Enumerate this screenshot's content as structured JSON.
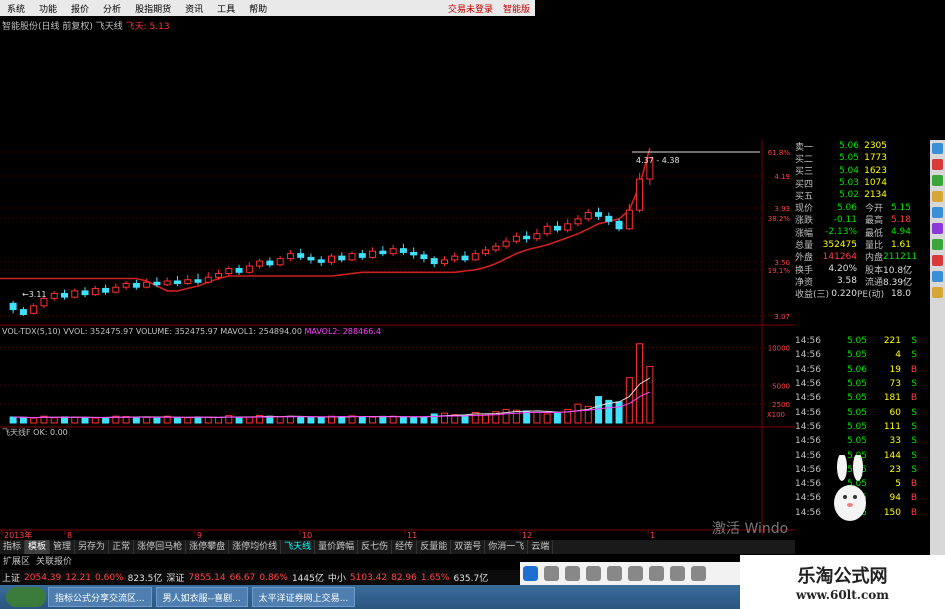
{
  "menu": [
    "系统",
    "功能",
    "报价",
    "分析",
    "股指期货",
    "资讯",
    "工具",
    "帮助"
  ],
  "menu_right": [
    "交易未登录",
    "智能版"
  ],
  "title": {
    "stock": "智能股份(日线 前复权)",
    "indicator": "飞天线",
    "value": "飞天: 5.13"
  },
  "price_axis": [
    "61.8%",
    "4.19",
    "3.93",
    "38.2%",
    "3.50",
    "19.1%",
    "3.07"
  ],
  "price_annot": {
    "range": "4.37 - 4.38",
    "low": "3.11"
  },
  "vol_header": {
    "name": "VOL-TDX(5,10)",
    "vvol": "VVOL: 352475.97",
    "volume": "VOLUME: 352475.97",
    "mavol1": "MAVOL1: 254894.00",
    "mavol2": "MAVOL2: 288466.4"
  },
  "vol_axis": [
    "10000",
    "5000",
    "2500",
    "X100"
  ],
  "ind_header": {
    "name": "飞天线F",
    "ok": "OK: 0.00"
  },
  "date_axis": [
    "2013年",
    "8",
    "9",
    "10",
    "11",
    "12",
    "1"
  ],
  "quote": {
    "asks": [
      {
        "label": "卖一",
        "price": "5.06",
        "vol": "2305"
      },
      {
        "label": "买二",
        "price": "5.05",
        "vol": "1773"
      },
      {
        "label": "买三",
        "price": "5.04",
        "vol": "1623"
      },
      {
        "label": "买四",
        "price": "5.03",
        "vol": "1074"
      },
      {
        "label": "买五",
        "price": "5.02",
        "vol": "2134"
      }
    ],
    "stats": [
      {
        "a": "现价",
        "b": "5.06",
        "bc": "green",
        "c": "今开",
        "d": "5.15",
        "dc": "green"
      },
      {
        "a": "涨跌",
        "b": "-0.11",
        "bc": "green",
        "c": "最高",
        "d": "5.18",
        "dc": "red"
      },
      {
        "a": "涨幅",
        "b": "-2.13%",
        "bc": "green",
        "c": "最低",
        "d": "4.94",
        "dc": "green"
      },
      {
        "a": "总量",
        "b": "352475",
        "bc": "yel",
        "c": "量比",
        "d": "1.61",
        "dc": "yel"
      },
      {
        "a": "外盘",
        "b": "141264",
        "bc": "red",
        "c": "内盘",
        "d": "211211",
        "dc": "green"
      },
      {
        "a": "换手",
        "b": "4.20%",
        "bc": "wht",
        "c": "股本",
        "d": "10.8亿",
        "dc": "wht"
      },
      {
        "a": "净资",
        "b": "3.58",
        "bc": "wht",
        "c": "流通",
        "d": "8.39亿",
        "dc": "wht"
      },
      {
        "a": "收益(三)",
        "b": "0.220",
        "bc": "wht",
        "c": "PE(动)",
        "d": "18.0",
        "dc": "wht"
      }
    ]
  },
  "ticks": [
    {
      "t": "14:56",
      "p": "5.05",
      "v": "221",
      "s": "S"
    },
    {
      "t": "14:56",
      "p": "5.05",
      "v": "4",
      "s": "S"
    },
    {
      "t": "14:56",
      "p": "5.06",
      "v": "19",
      "s": "B"
    },
    {
      "t": "14:56",
      "p": "5.05",
      "v": "73",
      "s": "S"
    },
    {
      "t": "14:56",
      "p": "5.05",
      "v": "181",
      "s": "B"
    },
    {
      "t": "14:56",
      "p": "5.05",
      "v": "60",
      "s": "S"
    },
    {
      "t": "14:56",
      "p": "5.05",
      "v": "111",
      "s": "S"
    },
    {
      "t": "14:56",
      "p": "5.05",
      "v": "33",
      "s": "S"
    },
    {
      "t": "14:56",
      "p": "5.05",
      "v": "144",
      "s": "S"
    },
    {
      "t": "14:56",
      "p": "5.05",
      "v": "23",
      "s": "S"
    },
    {
      "t": "14:56",
      "p": "5.05",
      "v": "5",
      "s": "B"
    },
    {
      "t": "14:56",
      "p": "5.05",
      "v": "94",
      "s": "B"
    },
    {
      "t": "14:56",
      "p": "5.05",
      "v": "150",
      "s": "B"
    }
  ],
  "tabs": [
    "指标",
    "模板",
    "管理",
    "另存为",
    "正常",
    "涨停回马枪",
    "涨停攀盘",
    "涨停均价线",
    "飞天线",
    "量价跨幅",
    "反七伤",
    "经传",
    "反量能",
    "双谐号",
    "你消一飞",
    "云端"
  ],
  "tab_active": 8,
  "subtabs": [
    "扩展区",
    "关联报价"
  ],
  "status": [
    {
      "t": "上证",
      "c": "wht"
    },
    {
      "t": "2054.39",
      "c": "red"
    },
    {
      "t": "12.21",
      "c": "red"
    },
    {
      "t": "0.60%",
      "c": "red"
    },
    {
      "t": "823.5亿",
      "c": "wht"
    },
    {
      "t": "深证",
      "c": "wht"
    },
    {
      "t": "7855.14",
      "c": "red"
    },
    {
      "t": "66.67",
      "c": "red"
    },
    {
      "t": "0.86%",
      "c": "red"
    },
    {
      "t": "1445亿",
      "c": "wht"
    },
    {
      "t": "中小",
      "c": "wht"
    },
    {
      "t": "5103.42",
      "c": "red"
    },
    {
      "t": "82.96",
      "c": "red"
    },
    {
      "t": "1.65%",
      "c": "red"
    },
    {
      "t": "635.7亿",
      "c": "wht"
    }
  ],
  "taskbar": [
    "指标公式分享交流区...",
    "男人如衣服--喜剧...",
    "太平洋证券网上交易..."
  ],
  "brand": {
    "cn": "乐淘公式网",
    "url": "www.60lt.com"
  },
  "watermark": "激活 Windo",
  "chart_data": {
    "type": "candlestick",
    "candles": [
      [
        3.2,
        3.15,
        3.22,
        3.12
      ],
      [
        3.15,
        3.11,
        3.17,
        3.1
      ],
      [
        3.12,
        3.18,
        3.2,
        3.11
      ],
      [
        3.18,
        3.24,
        3.26,
        3.16
      ],
      [
        3.24,
        3.28,
        3.3,
        3.22
      ],
      [
        3.28,
        3.25,
        3.31,
        3.23
      ],
      [
        3.25,
        3.3,
        3.32,
        3.24
      ],
      [
        3.3,
        3.27,
        3.33,
        3.25
      ],
      [
        3.27,
        3.32,
        3.34,
        3.26
      ],
      [
        3.32,
        3.29,
        3.35,
        3.27
      ],
      [
        3.29,
        3.33,
        3.36,
        3.28
      ],
      [
        3.33,
        3.36,
        3.38,
        3.31
      ],
      [
        3.36,
        3.33,
        3.39,
        3.31
      ],
      [
        3.33,
        3.37,
        3.4,
        3.32
      ],
      [
        3.37,
        3.35,
        3.41,
        3.33
      ],
      [
        3.35,
        3.38,
        3.41,
        3.34
      ],
      [
        3.38,
        3.36,
        3.42,
        3.34
      ],
      [
        3.36,
        3.39,
        3.43,
        3.35
      ],
      [
        3.39,
        3.37,
        3.44,
        3.35
      ],
      [
        3.37,
        3.41,
        3.45,
        3.36
      ],
      [
        3.41,
        3.44,
        3.47,
        3.39
      ],
      [
        3.44,
        3.48,
        3.5,
        3.42
      ],
      [
        3.48,
        3.45,
        3.51,
        3.43
      ],
      [
        3.45,
        3.5,
        3.53,
        3.44
      ],
      [
        3.5,
        3.54,
        3.56,
        3.48
      ],
      [
        3.54,
        3.51,
        3.57,
        3.49
      ],
      [
        3.51,
        3.56,
        3.58,
        3.5
      ],
      [
        3.56,
        3.6,
        3.63,
        3.54
      ],
      [
        3.6,
        3.57,
        3.64,
        3.55
      ],
      [
        3.57,
        3.55,
        3.6,
        3.52
      ],
      [
        3.55,
        3.53,
        3.58,
        3.5
      ],
      [
        3.53,
        3.58,
        3.6,
        3.51
      ],
      [
        3.58,
        3.55,
        3.61,
        3.53
      ],
      [
        3.55,
        3.6,
        3.62,
        3.54
      ],
      [
        3.6,
        3.57,
        3.63,
        3.55
      ],
      [
        3.57,
        3.62,
        3.65,
        3.56
      ],
      [
        3.62,
        3.6,
        3.66,
        3.58
      ],
      [
        3.6,
        3.64,
        3.67,
        3.58
      ],
      [
        3.64,
        3.61,
        3.68,
        3.59
      ],
      [
        3.61,
        3.59,
        3.65,
        3.56
      ],
      [
        3.59,
        3.56,
        3.62,
        3.53
      ],
      [
        3.56,
        3.52,
        3.58,
        3.49
      ],
      [
        3.52,
        3.55,
        3.58,
        3.5
      ],
      [
        3.55,
        3.58,
        3.61,
        3.53
      ],
      [
        3.58,
        3.55,
        3.62,
        3.53
      ],
      [
        3.55,
        3.6,
        3.63,
        3.54
      ],
      [
        3.6,
        3.63,
        3.66,
        3.58
      ],
      [
        3.63,
        3.66,
        3.69,
        3.61
      ],
      [
        3.66,
        3.7,
        3.73,
        3.64
      ],
      [
        3.7,
        3.74,
        3.77,
        3.68
      ],
      [
        3.74,
        3.72,
        3.78,
        3.69
      ],
      [
        3.72,
        3.76,
        3.8,
        3.7
      ],
      [
        3.76,
        3.82,
        3.85,
        3.74
      ],
      [
        3.82,
        3.79,
        3.86,
        3.77
      ],
      [
        3.79,
        3.84,
        3.88,
        3.77
      ],
      [
        3.84,
        3.88,
        3.91,
        3.82
      ],
      [
        3.88,
        3.93,
        3.96,
        3.86
      ],
      [
        3.93,
        3.9,
        3.97,
        3.87
      ],
      [
        3.9,
        3.86,
        3.93,
        3.83
      ],
      [
        3.86,
        3.8,
        3.88,
        3.78
      ],
      [
        3.8,
        3.95,
        4.0,
        3.79
      ],
      [
        3.95,
        4.2,
        4.25,
        3.93
      ],
      [
        4.2,
        4.37,
        4.38,
        4.15
      ]
    ],
    "ma": [
      3.4,
      3.4,
      3.4,
      3.4,
      3.4,
      3.4,
      3.4,
      3.4,
      3.4,
      3.4,
      3.4,
      3.4,
      3.4,
      3.38,
      3.34,
      3.3,
      3.3,
      3.32,
      3.34,
      3.37,
      3.4,
      3.42,
      3.42,
      3.42,
      3.42,
      3.42,
      3.42,
      3.42,
      3.42,
      3.42,
      3.42,
      3.42,
      3.43,
      3.44,
      3.45,
      3.45,
      3.45,
      3.45,
      3.45,
      3.45,
      3.45,
      3.45,
      3.45,
      3.45,
      3.46,
      3.47,
      3.49,
      3.52,
      3.56,
      3.6,
      3.63,
      3.65,
      3.67,
      3.7,
      3.73,
      3.76,
      3.8,
      3.84,
      3.86,
      3.88,
      3.95,
      4.15,
      4.45
    ],
    "volumes": [
      800,
      700,
      650,
      900,
      700,
      800,
      750,
      700,
      680,
      720,
      900,
      850,
      800,
      750,
      700,
      900,
      650,
      700,
      800,
      760,
      720,
      980,
      700,
      800,
      1000,
      900,
      850,
      900,
      750,
      700,
      800,
      900,
      850,
      950,
      820,
      780,
      880,
      900,
      780,
      700,
      800,
      1200,
      1300,
      1100,
      1000,
      1400,
      1200,
      1500,
      1800,
      1700,
      1600,
      1400,
      1200,
      1300,
      1800,
      2500,
      2200,
      3500,
      3000,
      2800,
      6000,
      10500,
      7500
    ],
    "ylim": [
      3.05,
      4.45
    ],
    "vol_ylim": [
      0,
      11000
    ]
  }
}
